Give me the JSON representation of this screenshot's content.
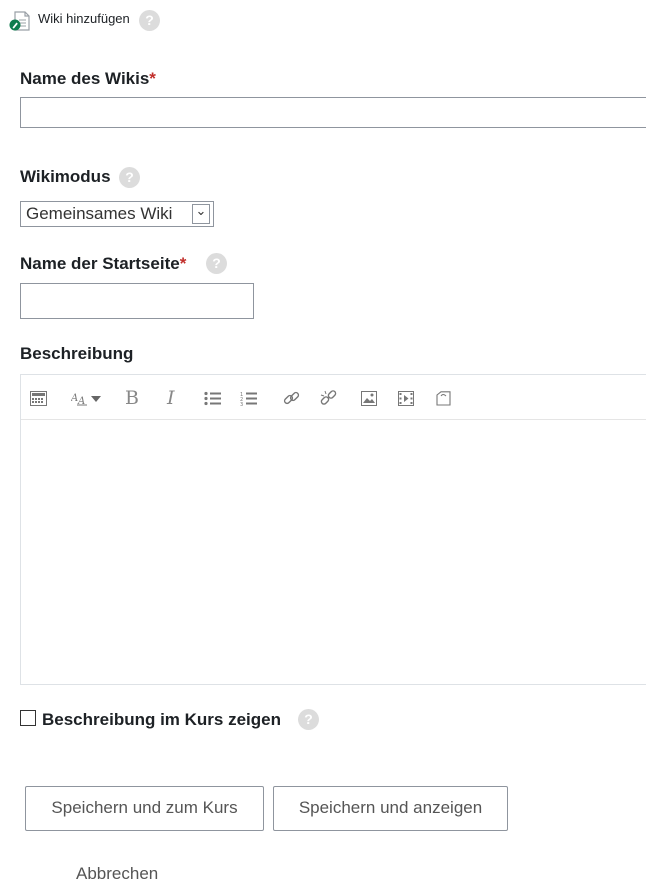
{
  "header": {
    "title": "Wiki hinzufügen"
  },
  "fields": {
    "wiki_name": {
      "label": "Name des Wikis",
      "required_mark": "*",
      "value": ""
    },
    "wiki_mode": {
      "label": "Wikimodus",
      "selected": "Gemeinsames Wiki",
      "arrow": "⌄"
    },
    "start_page": {
      "label": "Name der Startseite",
      "required_mark": "*",
      "value": ""
    },
    "description": {
      "label": "Beschreibung"
    },
    "show_description": {
      "label": "Beschreibung im Kurs zeigen",
      "checked": false
    }
  },
  "help_glyph": "?",
  "editor_toolbar": {
    "icons": [
      "toolbar-toggle-icon",
      "font-style-icon",
      "bold-icon",
      "italic-icon",
      "unordered-list-icon",
      "ordered-list-icon",
      "link-icon",
      "unlink-icon",
      "image-icon",
      "media-icon",
      "manage-files-icon"
    ],
    "bold_glyph": "B",
    "italic_glyph": "I"
  },
  "buttons": {
    "save_return": "Speichern und zum Kurs",
    "save_display": "Speichern und anzeigen",
    "cancel": "Abbrechen"
  },
  "colors": {
    "required": "#c12e2a",
    "help_icon": "#dcdcdc",
    "border": "#8f959e"
  }
}
